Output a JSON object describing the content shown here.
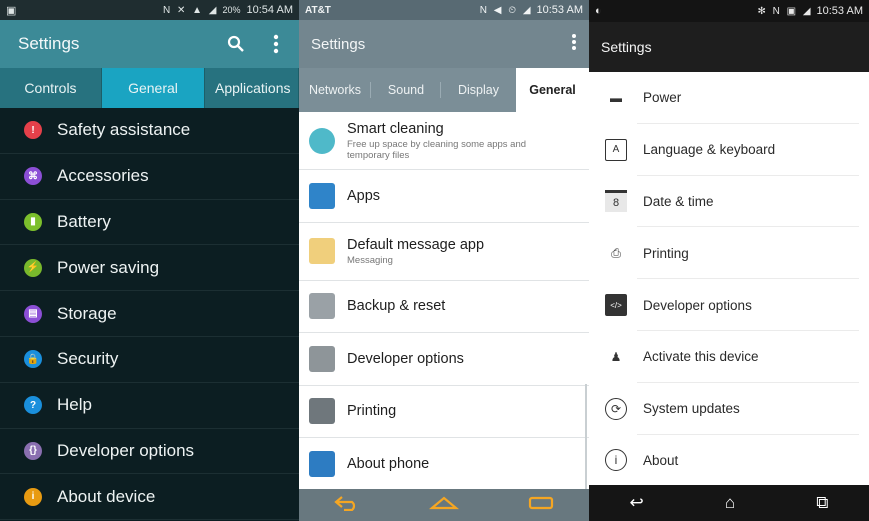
{
  "samsung": {
    "status": {
      "icons": "N ✕ ▲ ◢",
      "battery": "20%",
      "time": "10:54 AM"
    },
    "appbar": {
      "title": "Settings"
    },
    "tabs": [
      "Controls",
      "General",
      "Applications"
    ],
    "items": [
      {
        "label": "Safety assistance",
        "icon": "alert-icon",
        "color": "#e5404a"
      },
      {
        "label": "Accessories",
        "icon": "accessories-icon",
        "color": "#8c4fd6"
      },
      {
        "label": "Battery",
        "icon": "battery-icon",
        "color": "#7cbf2c"
      },
      {
        "label": "Power saving",
        "icon": "power-saving-icon",
        "color": "#79b82c"
      },
      {
        "label": "Storage",
        "icon": "storage-icon",
        "color": "#8c4fd6"
      },
      {
        "label": "Security",
        "icon": "lock-icon",
        "color": "#1a8fdc"
      },
      {
        "label": "Help",
        "icon": "help-icon",
        "color": "#1a8fdc"
      },
      {
        "label": "Developer options",
        "icon": "developer-icon",
        "color": "#8a6fb0"
      },
      {
        "label": "About device",
        "icon": "info-icon",
        "color": "#e89b12"
      }
    ]
  },
  "sony": {
    "status": {
      "carrier": "AT&T",
      "icons": "N ◀ ⏲ ◢",
      "time": "10:53 AM"
    },
    "appbar": {
      "title": "Settings"
    },
    "tabs": [
      "Networks",
      "Sound",
      "Display",
      "General"
    ],
    "items": [
      {
        "label": "Smart cleaning",
        "sub": "Free up space by cleaning some apps and temporary files",
        "icon": "smart-cleaning-icon",
        "color": "#4fb9c9"
      },
      {
        "label": "Apps",
        "sub": "",
        "icon": "apps-icon",
        "color": "#2f84c9"
      },
      {
        "label": "Default message app",
        "sub": "Messaging",
        "icon": "message-icon",
        "color": "#f0cf7c"
      },
      {
        "label": "Backup & reset",
        "sub": "",
        "icon": "backup-icon",
        "color": "#9aa1a6"
      },
      {
        "label": "Developer options",
        "sub": "",
        "icon": "developer-icon",
        "color": "#8e9599"
      },
      {
        "label": "Printing",
        "sub": "",
        "icon": "printer-icon",
        "color": "#6f777c"
      },
      {
        "label": "About phone",
        "sub": "",
        "icon": "phone-icon",
        "color": "#2d7cc2"
      }
    ],
    "nav": [
      "back-icon",
      "home-icon",
      "recents-icon"
    ]
  },
  "htc": {
    "status": {
      "icons": "✻ N ▣ ◢",
      "time": "10:53 AM"
    },
    "appbar": {
      "title": "Settings"
    },
    "items": [
      {
        "label": "Power",
        "icon": "battery-icon",
        "glyph": "▬"
      },
      {
        "label": "Language & keyboard",
        "icon": "language-icon",
        "glyph": "A"
      },
      {
        "label": "Date & time",
        "icon": "calendar-icon",
        "glyph": "8"
      },
      {
        "label": "Printing",
        "icon": "printer-icon",
        "glyph": "⎙"
      },
      {
        "label": "Developer options",
        "icon": "developer-icon",
        "glyph": "</>"
      },
      {
        "label": "Activate this device",
        "icon": "activate-icon",
        "glyph": "♟"
      },
      {
        "label": "System updates",
        "icon": "system-update-icon",
        "glyph": "⟳"
      },
      {
        "label": "About",
        "icon": "info-icon",
        "glyph": "i"
      }
    ],
    "nav": {
      "back": "↩",
      "home": "⌂",
      "recents": "⧉"
    }
  }
}
